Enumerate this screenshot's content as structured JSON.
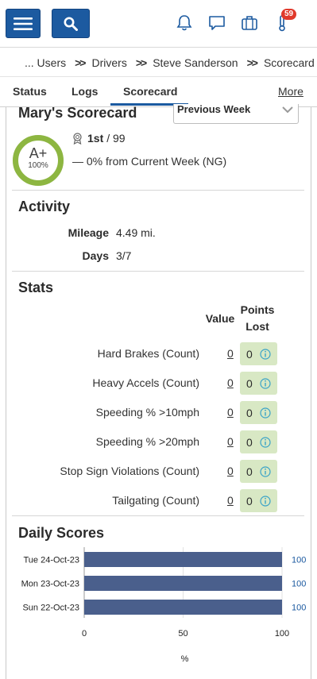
{
  "topbar": {
    "menu_icon": "hamburger-menu-icon",
    "search_icon": "search-icon",
    "icons": [
      "bell-icon",
      "chat-icon",
      "briefcase-icon",
      "thermometer-icon"
    ],
    "notification_badge": "59",
    "accent": "#1c5aa0",
    "badge_color": "#e0392b"
  },
  "breadcrumb": {
    "items": [
      "... Users",
      "Drivers",
      "Steve Sanderson",
      "Scorecard"
    ],
    "separator": ">>"
  },
  "tabs": {
    "items": [
      "Status",
      "Logs",
      "Scorecard"
    ],
    "active": "Scorecard",
    "more_label": "More"
  },
  "scorecard": {
    "title": "Mary's Scorecard",
    "period_select": "Previous Week",
    "grade": "A+",
    "grade_pct": "100%",
    "grade_ring_fraction": 1.0,
    "grade_color": "#8db641",
    "rank": "1st",
    "rank_total": "/ 99",
    "trend": "— 0% from Current Week (NG)"
  },
  "activity": {
    "title": "Activity",
    "rows": [
      {
        "label": "Mileage",
        "value": "4.49 mi."
      },
      {
        "label": "Days",
        "value": "3/7"
      }
    ]
  },
  "stats": {
    "title": "Stats",
    "col_value": "Value",
    "col_points_1": "Points",
    "col_points_2": "Lost",
    "points_bg": "#d8e8c4",
    "rows": [
      {
        "label": "Hard Brakes (Count)",
        "value": "0",
        "points": "0"
      },
      {
        "label": "Heavy Accels (Count)",
        "value": "0",
        "points": "0"
      },
      {
        "label": "Speeding % >10mph",
        "value": "0",
        "points": "0"
      },
      {
        "label": "Speeding % >20mph",
        "value": "0",
        "points": "0"
      },
      {
        "label": "Stop Sign Violations (Count)",
        "value": "0",
        "points": "0"
      },
      {
        "label": "Tailgating (Count)",
        "value": "0",
        "points": "0"
      }
    ]
  },
  "chart_data": {
    "type": "bar",
    "orientation": "horizontal",
    "title": "Daily Scores",
    "categories": [
      "Tue 24-Oct-23",
      "Mon 23-Oct-23",
      "Sun 22-Oct-23"
    ],
    "values": [
      100,
      100,
      100
    ],
    "data_labels": [
      "100",
      "100",
      "100"
    ],
    "xlabel": "%",
    "xticks": [
      "0",
      "50",
      "100"
    ],
    "xlim": [
      0,
      100
    ],
    "grid": true,
    "bar_color": "#4a5f8c",
    "label_color": "#1c5aa0"
  }
}
